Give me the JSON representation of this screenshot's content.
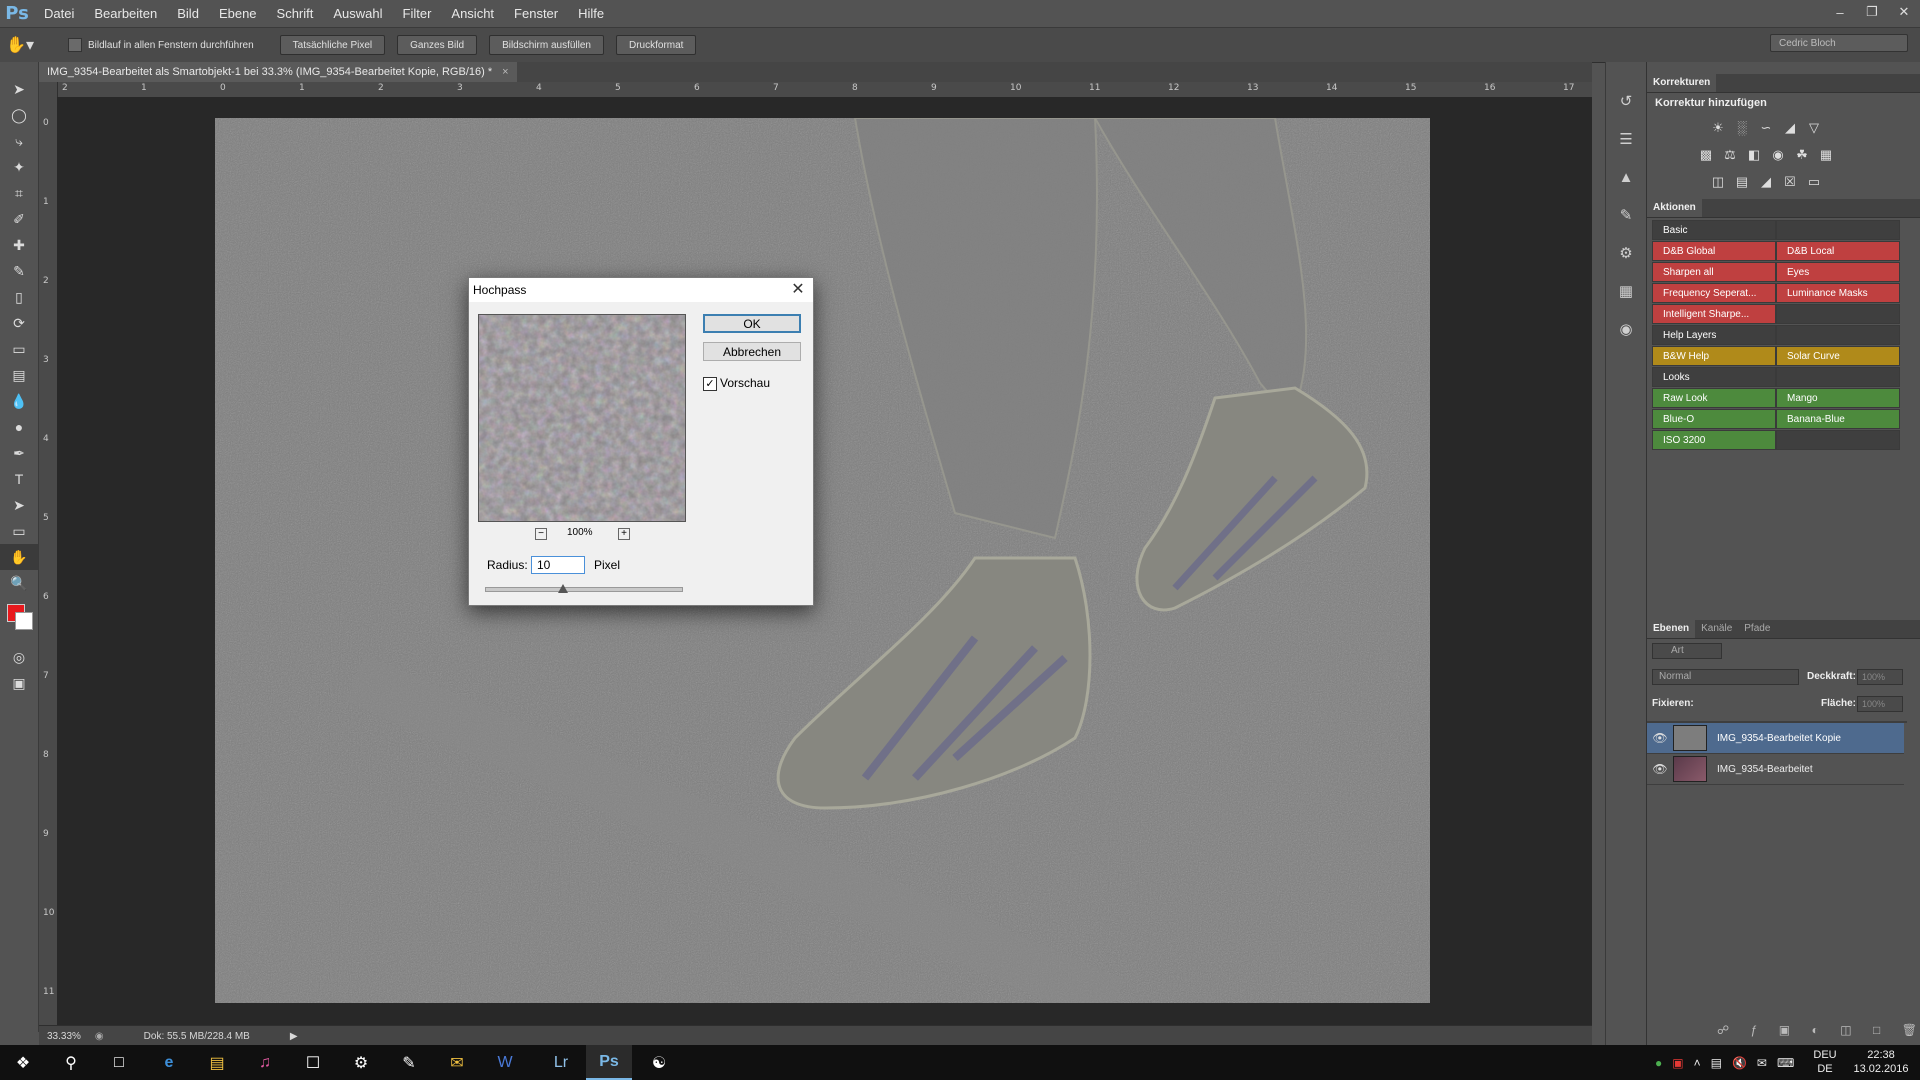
{
  "app": {
    "logo": "Ps",
    "accent": "#7ab8e6"
  },
  "menu": [
    "Datei",
    "Bearbeiten",
    "Bild",
    "Ebene",
    "Schrift",
    "Auswahl",
    "Filter",
    "Ansicht",
    "Fenster",
    "Hilfe"
  ],
  "options_bar": {
    "scroll_all_label": "Bildlauf in allen Fenstern durchführen",
    "buttons": [
      "Tatsächliche Pixel",
      "Ganzes Bild",
      "Bildschirm ausfüllen",
      "Druckformat"
    ],
    "workspace": "Cedric Bloch"
  },
  "document": {
    "tab_title": "IMG_9354-Bearbeitet als Smartobjekt-1 bei 33.3% (IMG_9354-Bearbeitet Kopie, RGB/16) *",
    "ruler_h": [
      "2",
      "1",
      "0",
      "1",
      "2",
      "3",
      "4",
      "5",
      "6",
      "7",
      "8",
      "9",
      "10",
      "11",
      "12",
      "13",
      "14",
      "15",
      "16",
      "17"
    ],
    "ruler_v": [
      "0",
      "1",
      "2",
      "3",
      "4",
      "5",
      "6",
      "7",
      "8",
      "9",
      "10",
      "11"
    ],
    "zoom": "33.33%",
    "doc_info": "Dok: 55.5 MB/228.4 MB"
  },
  "dialog": {
    "title": "Hochpass",
    "ok": "OK",
    "cancel": "Abbrechen",
    "preview_label": "Vorschau",
    "preview_checked": true,
    "preview_zoom": "100%",
    "radius_label": "Radius:",
    "radius_value": "10",
    "radius_unit": "Pixel"
  },
  "panels": {
    "corrections_tab": "Korrekturen",
    "corrections_header": "Korrektur hinzufügen",
    "actions_tab": "Aktionen",
    "actions": [
      {
        "left": "Basic",
        "right": "",
        "color": "#3f3f3f"
      },
      {
        "left": "D&B Global",
        "right": "D&B Local",
        "color": "#bf4040"
      },
      {
        "left": "Sharpen all",
        "right": "Eyes",
        "color": "#bf4040"
      },
      {
        "left": "Frequency Seperat...",
        "right": "Luminance Masks",
        "color": "#bf4040"
      },
      {
        "left": "Intelligent Sharpe...",
        "right": "",
        "color": "#bf4040"
      },
      {
        "left": "Help Layers",
        "right": "",
        "color": "#3f3f3f"
      },
      {
        "left": "B&W Help",
        "right": "Solar Curve",
        "color": "#b08a1a"
      },
      {
        "left": "Looks",
        "right": "",
        "color": "#3f3f3f"
      },
      {
        "left": "Raw Look",
        "right": "Mango",
        "color": "#4d8a3d"
      },
      {
        "left": "Blue-O",
        "right": "Banana-Blue",
        "color": "#4d8a3d"
      },
      {
        "left": "ISO 3200",
        "right": "",
        "color": "#4d8a3d"
      }
    ],
    "layers_tabs": [
      "Ebenen",
      "Kanäle",
      "Pfade"
    ],
    "filter_kind": "Art",
    "blend_mode": "Normal",
    "opacity_label": "Deckkraft:",
    "opacity_value": "100%",
    "lock_label": "Fixieren:",
    "fill_label": "Fläche:",
    "fill_value": "100%",
    "layers": [
      {
        "name": "IMG_9354-Bearbeitet Kopie",
        "selected": true
      },
      {
        "name": "IMG_9354-Bearbeitet",
        "selected": false
      }
    ]
  },
  "taskbar": {
    "lang_top": "DEU",
    "lang_bottom": "DE",
    "time": "22:38",
    "date": "13.02.2016"
  }
}
